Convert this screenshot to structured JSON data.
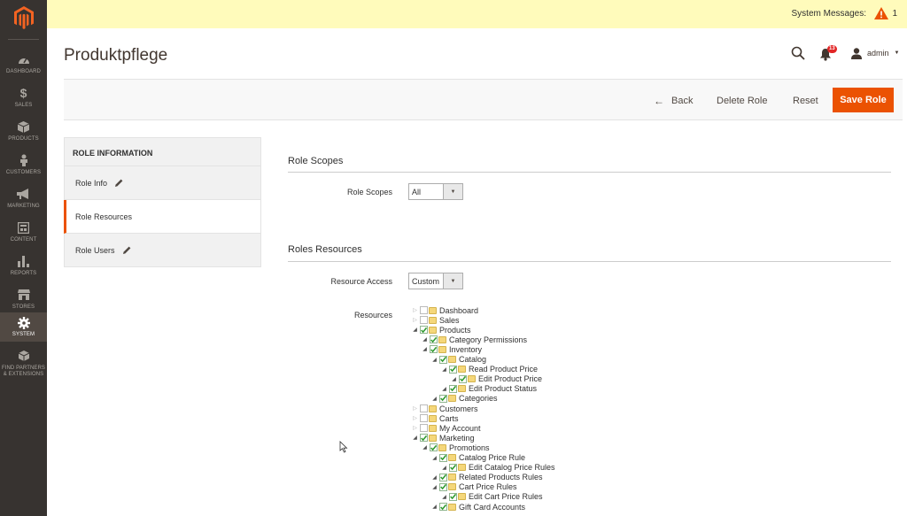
{
  "sidebar": {
    "items": [
      {
        "label": "DASHBOARD",
        "icon": "dashboard-icon"
      },
      {
        "label": "SALES",
        "icon": "dollar-icon"
      },
      {
        "label": "PRODUCTS",
        "icon": "cube-icon"
      },
      {
        "label": "CUSTOMERS",
        "icon": "person-icon"
      },
      {
        "label": "MARKETING",
        "icon": "megaphone-icon"
      },
      {
        "label": "CONTENT",
        "icon": "layout-icon"
      },
      {
        "label": "REPORTS",
        "icon": "bar-chart-icon"
      },
      {
        "label": "STORES",
        "icon": "storefront-icon"
      },
      {
        "label": "SYSTEM",
        "icon": "gear-icon"
      },
      {
        "label": "FIND PARTNERS & EXTENSIONS",
        "icon": "boxes-icon"
      }
    ]
  },
  "messages": {
    "label": "System Messages:",
    "count": "1"
  },
  "header": {
    "title": "Produktpflege",
    "notifications": "13",
    "user": "admin"
  },
  "actions": {
    "back": "Back",
    "delete": "Delete Role",
    "reset": "Reset",
    "save": "Save Role"
  },
  "tabs": {
    "title": "ROLE INFORMATION",
    "items": [
      "Role Info",
      "Role Resources",
      "Role Users"
    ]
  },
  "scopes": {
    "title": "Role Scopes",
    "label": "Role Scopes",
    "value": "All"
  },
  "resources": {
    "title": "Roles Resources",
    "access_label": "Resource Access",
    "access_value": "Custom",
    "tree_label": "Resources",
    "tree": [
      {
        "label": "Dashboard",
        "level": 0,
        "open": false,
        "checked": false
      },
      {
        "label": "Sales",
        "level": 0,
        "open": false,
        "checked": false
      },
      {
        "label": "Products",
        "level": 0,
        "open": true,
        "checked": true
      },
      {
        "label": "Category Permissions",
        "level": 1,
        "open": true,
        "checked": true
      },
      {
        "label": "Inventory",
        "level": 1,
        "open": true,
        "checked": true
      },
      {
        "label": "Catalog",
        "level": 2,
        "open": true,
        "checked": true
      },
      {
        "label": "Read Product Price",
        "level": 3,
        "open": true,
        "checked": true
      },
      {
        "label": "Edit Product Price",
        "level": 4,
        "open": true,
        "checked": true
      },
      {
        "label": "Edit Product Status",
        "level": 3,
        "open": true,
        "checked": true
      },
      {
        "label": "Categories",
        "level": 2,
        "open": true,
        "checked": true
      },
      {
        "label": "Customers",
        "level": 0,
        "open": false,
        "checked": false
      },
      {
        "label": "Carts",
        "level": 0,
        "open": false,
        "checked": false
      },
      {
        "label": "My Account",
        "level": 0,
        "open": false,
        "checked": false
      },
      {
        "label": "Marketing",
        "level": 0,
        "open": true,
        "checked": true
      },
      {
        "label": "Promotions",
        "level": 1,
        "open": true,
        "checked": true
      },
      {
        "label": "Catalog Price Rule",
        "level": 2,
        "open": true,
        "checked": true
      },
      {
        "label": "Edit Catalog Price Rules",
        "level": 3,
        "open": true,
        "checked": true
      },
      {
        "label": "Related Products Rules",
        "level": 2,
        "open": true,
        "checked": true
      },
      {
        "label": "Cart Price Rules",
        "level": 2,
        "open": true,
        "checked": true
      },
      {
        "label": "Edit Cart Price Rules",
        "level": 3,
        "open": true,
        "checked": true
      },
      {
        "label": "Gift Card Accounts",
        "level": 2,
        "open": true,
        "checked": true
      }
    ]
  },
  "colors": {
    "accent": "#eb5202",
    "sidebar": "#373330",
    "message_bar": "#fffbbb",
    "check": "#2e9a2e"
  }
}
